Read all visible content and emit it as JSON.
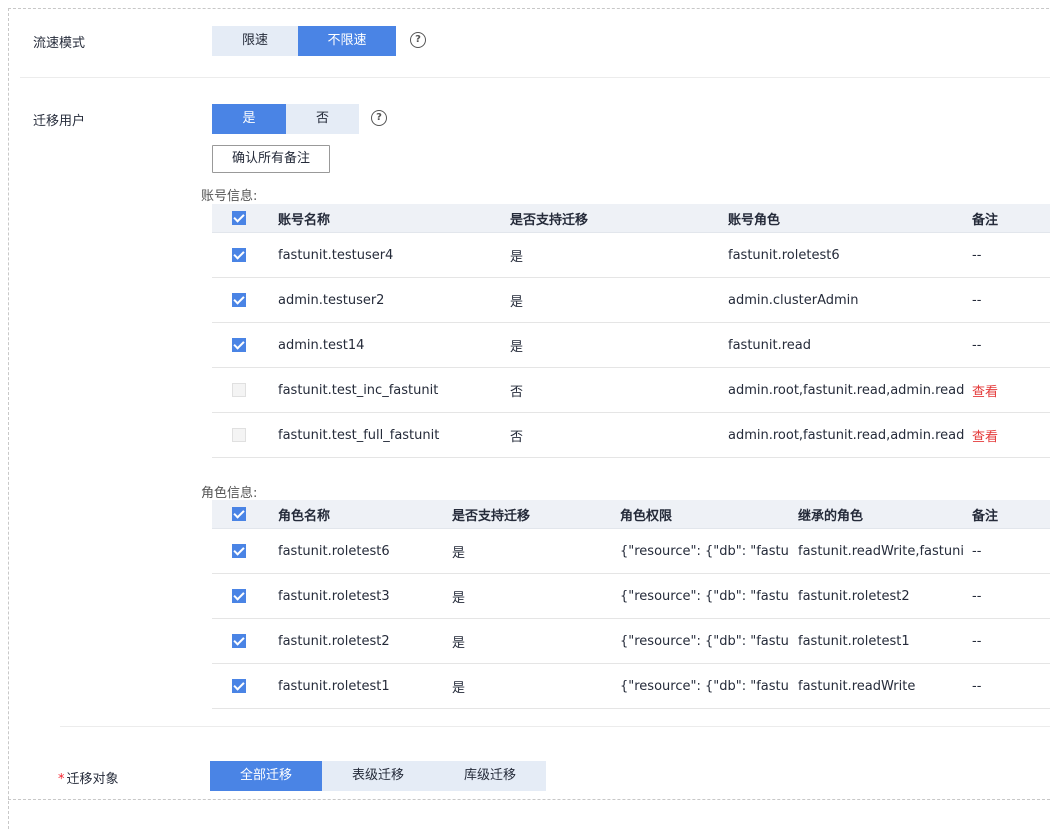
{
  "flow_mode": {
    "label": "流速模式",
    "options": [
      "限速",
      "不限速"
    ],
    "selected": "不限速",
    "help": "?"
  },
  "migrate_users": {
    "label": "迁移用户",
    "options": [
      "是",
      "否"
    ],
    "selected": "是",
    "help": "?",
    "confirm_button": "确认所有备注"
  },
  "account_info": {
    "title": "账号信息:",
    "columns": [
      "账号名称",
      "是否支持迁移",
      "账号角色",
      "备注"
    ],
    "rows": [
      {
        "checked": true,
        "disabled": false,
        "name": "fastunit.testuser4",
        "supported": "是",
        "role": "fastunit.roletest6",
        "remark": "--"
      },
      {
        "checked": true,
        "disabled": false,
        "name": "admin.testuser2",
        "supported": "是",
        "role": "admin.clusterAdmin",
        "remark": "--"
      },
      {
        "checked": true,
        "disabled": false,
        "name": "admin.test14",
        "supported": "是",
        "role": "fastunit.read",
        "remark": "--"
      },
      {
        "checked": false,
        "disabled": true,
        "name": "fastunit.test_inc_fastunit",
        "supported": "否",
        "role": "admin.root,fastunit.read,admin.read...",
        "remark": "查看"
      },
      {
        "checked": false,
        "disabled": true,
        "name": "fastunit.test_full_fastunit",
        "supported": "否",
        "role": "admin.root,fastunit.read,admin.read...",
        "remark": "查看"
      }
    ]
  },
  "role_info": {
    "title": "角色信息:",
    "columns": [
      "角色名称",
      "是否支持迁移",
      "角色权限",
      "继承的角色",
      "备注"
    ],
    "rows": [
      {
        "checked": true,
        "name": "fastunit.roletest6",
        "supported": "是",
        "privilege": "{\"resource\": {\"db\": \"fastu...",
        "inherited": "fastunit.readWrite,fastuni...",
        "remark": "--"
      },
      {
        "checked": true,
        "name": "fastunit.roletest3",
        "supported": "是",
        "privilege": "{\"resource\": {\"db\": \"fastu...",
        "inherited": "fastunit.roletest2",
        "remark": "--"
      },
      {
        "checked": true,
        "name": "fastunit.roletest2",
        "supported": "是",
        "privilege": "{\"resource\": {\"db\": \"fastu...",
        "inherited": "fastunit.roletest1",
        "remark": "--"
      },
      {
        "checked": true,
        "name": "fastunit.roletest1",
        "supported": "是",
        "privilege": "{\"resource\": {\"db\": \"fastu...",
        "inherited": "fastunit.readWrite",
        "remark": "--"
      }
    ]
  },
  "migrate_object": {
    "required_mark": "*",
    "label": "迁移对象",
    "options": [
      "全部迁移",
      "表级迁移",
      "库级迁移"
    ],
    "selected": "全部迁移"
  },
  "colors": {
    "accent": "#4a84e5",
    "segment_bg": "#e5ecf6",
    "link_red": "#e43a3a"
  }
}
